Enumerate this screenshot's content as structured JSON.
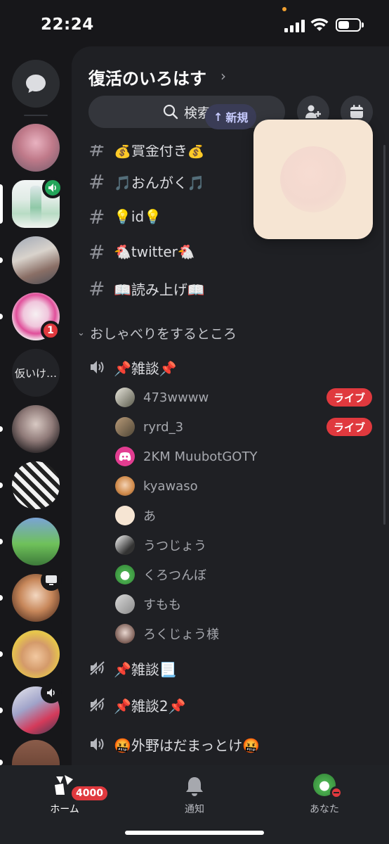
{
  "status_bar": {
    "time": "22:24",
    "battery_level": 0.55
  },
  "server_rail": {
    "folder_label": "仮いけ…",
    "badge_count": "1",
    "accent_colors": {
      "mention_badge": "#e0393e",
      "voice_badge": "#23a55a"
    }
  },
  "header": {
    "server_name": "復活のいろはす",
    "search_label": "検索"
  },
  "new_indicator": {
    "label": "新規",
    "icon": "arrow-up-icon"
  },
  "channels_top": [
    {
      "name": "💰賞金付き💰",
      "icon": "hash-icon"
    },
    {
      "name": "🎵おんがく🎵",
      "icon": "hash-icon"
    },
    {
      "name": "💡id💡",
      "icon": "hash-icon"
    },
    {
      "name": "🐔twitter🐔",
      "icon": "hash-icon"
    },
    {
      "name": "📖読み上げ📖",
      "icon": "hash-icon"
    }
  ],
  "category": {
    "name": "おしゃべりをするところ"
  },
  "voice_channels": [
    {
      "name": "📌雑談📌",
      "icon": "speaker-icon"
    },
    {
      "name": "📌雑談📃",
      "icon": "speaker-muted-icon"
    },
    {
      "name": "📌雑談2📌",
      "icon": "speaker-muted-icon"
    },
    {
      "name": "🤬外野はだまっとけ🤬",
      "icon": "speaker-icon"
    }
  ],
  "voice_members": [
    {
      "name": "473wwww",
      "live": "ライブ"
    },
    {
      "name": "ryrd_3",
      "live": "ライブ"
    },
    {
      "name": "2KM MuubotGOTY",
      "live": ""
    },
    {
      "name": "kyawaso",
      "live": ""
    },
    {
      "name": "あ",
      "live": ""
    },
    {
      "name": "うつじょう",
      "live": ""
    },
    {
      "name": "くろつんぼ",
      "live": ""
    },
    {
      "name": "すもも",
      "live": ""
    },
    {
      "name": "ろくじょう様",
      "live": ""
    }
  ],
  "tab_bar": {
    "home_label": "ホーム",
    "home_badge": "4000",
    "notifications_label": "通知",
    "you_label": "あなた"
  }
}
